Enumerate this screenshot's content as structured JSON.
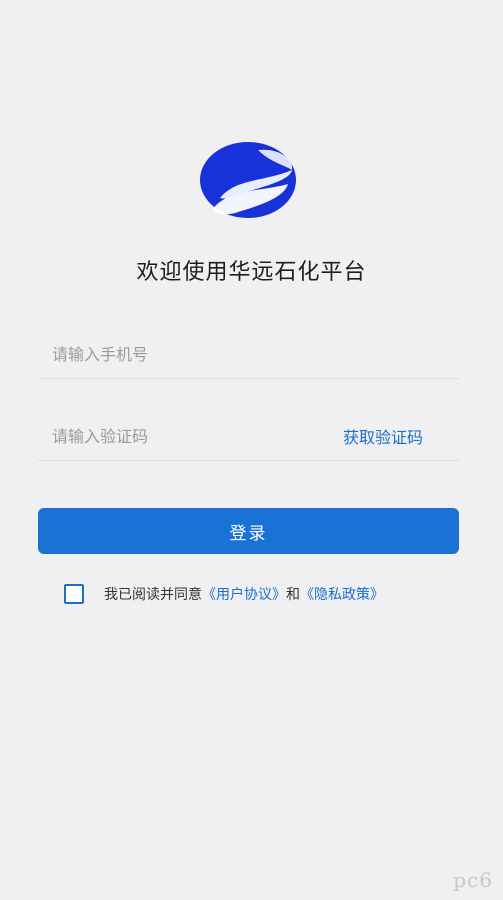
{
  "app": {
    "welcome_title": "欢迎使用华远石化平台"
  },
  "form": {
    "phone_placeholder": "请输入手机号",
    "phone_value": "",
    "code_placeholder": "请输入验证码",
    "code_value": "",
    "get_code_label": "获取验证码",
    "login_label": "登录"
  },
  "agreement": {
    "checked": false,
    "prefix": "我已阅读并同意",
    "user_agreement": "《用户协议》",
    "connector": "和",
    "privacy_policy": "《隐私政策》"
  },
  "watermark": {
    "text": "pc6"
  },
  "colors": {
    "background": "#f0eff2",
    "primary": "#1a73d4",
    "link": "#1a6fc9",
    "logo_blue": "#1632d8"
  }
}
